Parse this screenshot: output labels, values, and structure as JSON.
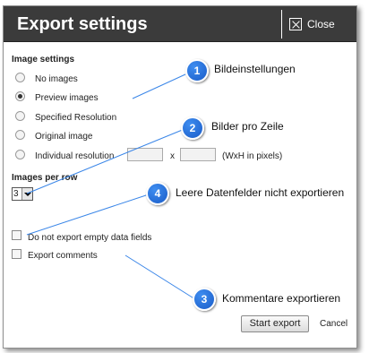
{
  "dialog": {
    "title": "Export settings",
    "close_label": "Close"
  },
  "image_settings": {
    "label": "Image settings",
    "options": [
      {
        "label": "No images",
        "selected": false
      },
      {
        "label": "Preview images",
        "selected": true
      },
      {
        "label": "Specified Resolution",
        "selected": false
      },
      {
        "label": "Original image",
        "selected": false
      },
      {
        "label": "Individual resolution",
        "selected": false
      }
    ],
    "width_value": "",
    "height_value": "",
    "separator": "x",
    "hint": "(WxH in pixels)"
  },
  "images_per_row": {
    "label": "Images per row",
    "value": "3"
  },
  "checkboxes": {
    "empty_fields_label": "Do not export empty data fields",
    "empty_fields_checked": false,
    "comments_label": "Export comments",
    "comments_checked": false
  },
  "buttons": {
    "start_export": "Start export",
    "cancel": "Cancel"
  },
  "callouts": [
    {
      "number": "1",
      "text": "Bildeinstellungen"
    },
    {
      "number": "2",
      "text": "Bilder pro Zeile"
    },
    {
      "number": "3",
      "text": "Kommentare exportieren"
    },
    {
      "number": "4",
      "text": "Leere Datenfelder nicht exportieren"
    }
  ],
  "colors": {
    "titlebar": "#3b3b3b",
    "badge": "#2a72dc",
    "leader_line": "#3a86e8"
  }
}
